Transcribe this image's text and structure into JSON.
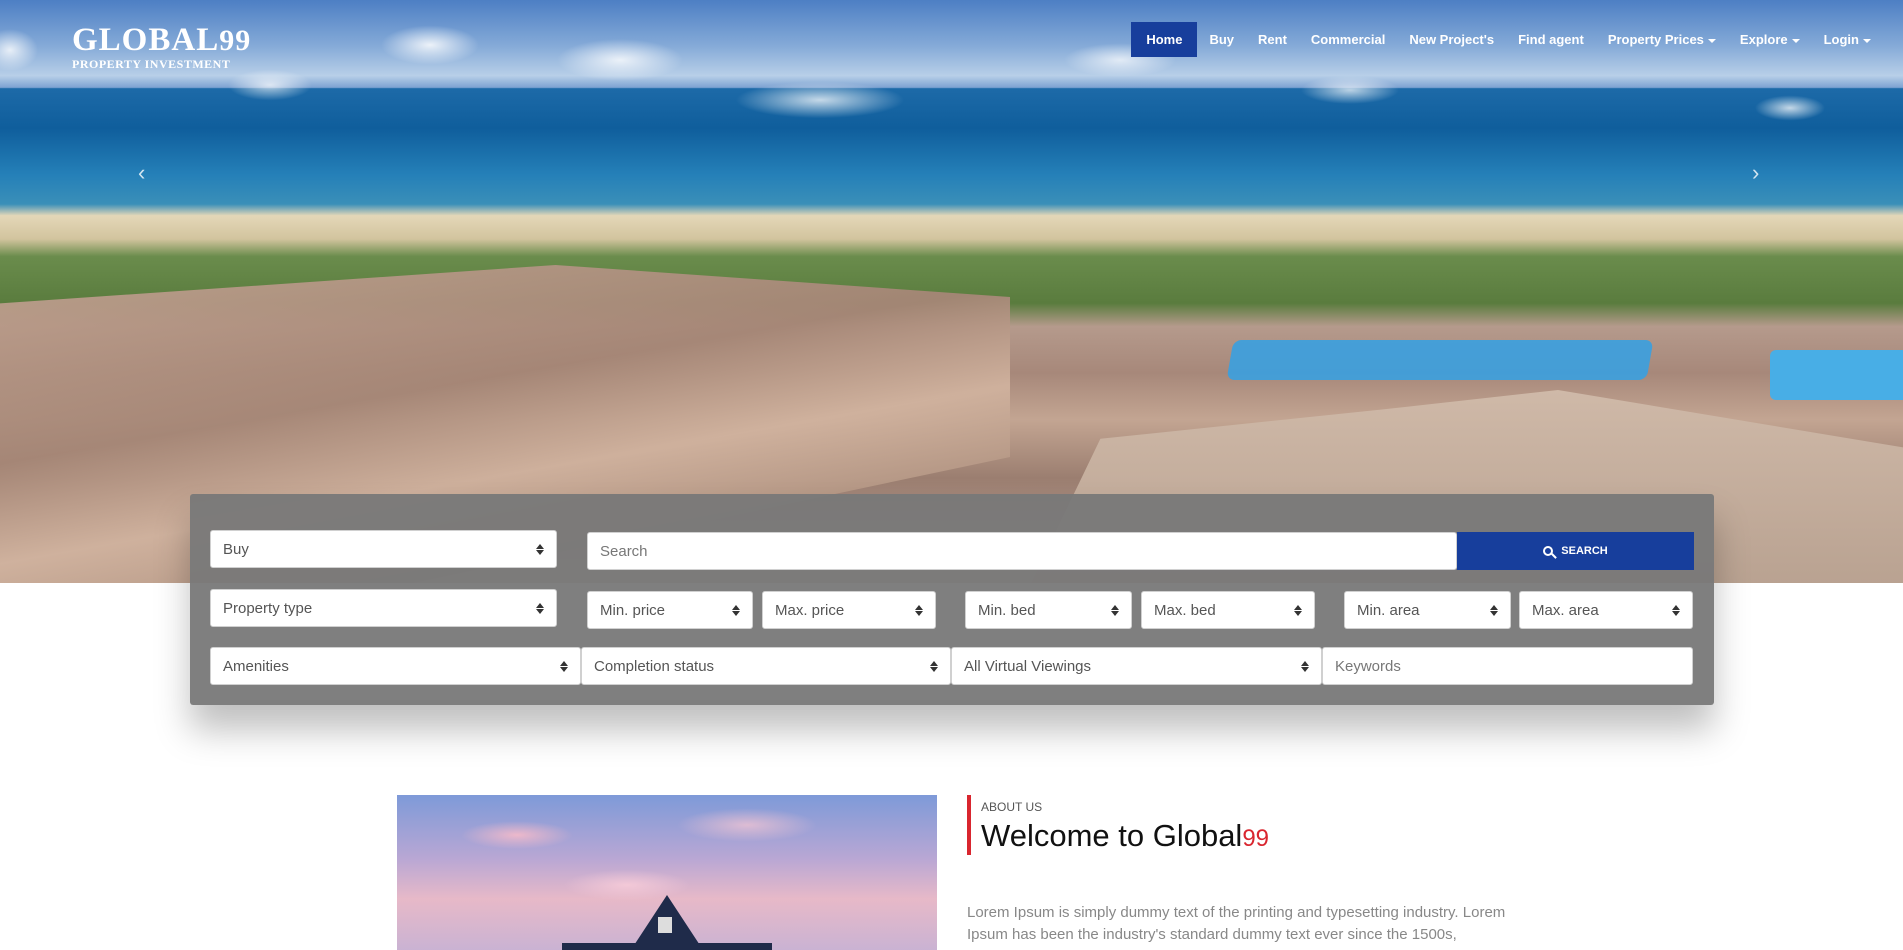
{
  "brand": {
    "name": "GLOBAL",
    "number": "99",
    "tagline": "PROPERTY INVESTMENT"
  },
  "nav": {
    "items": [
      {
        "label": "Home",
        "active": true
      },
      {
        "label": "Buy"
      },
      {
        "label": "Rent"
      },
      {
        "label": "Commercial"
      },
      {
        "label": "New Project's"
      },
      {
        "label": "Find agent"
      },
      {
        "label": "Property Prices",
        "dropdown": true
      },
      {
        "label": "Explore",
        "dropdown": true
      },
      {
        "label": "Login",
        "dropdown": true
      }
    ]
  },
  "carousel": {
    "prev_icon": "‹",
    "next_icon": "›"
  },
  "search": {
    "purpose": "Buy",
    "search_placeholder": "Search",
    "search_button": "SEARCH",
    "property_type": "Property type",
    "min_price": "Min. price",
    "max_price": "Max. price",
    "min_bed": "Min. bed",
    "max_bed": "Max. bed",
    "min_area": "Min. area",
    "max_area": "Max. area",
    "amenities": "Amenities",
    "completion_status": "Completion status",
    "virtual_viewings": "All Virtual Viewings",
    "keywords_placeholder": "Keywords"
  },
  "about": {
    "label": "ABOUT US",
    "title": "Welcome to Global",
    "title_number": "99",
    "text": "Lorem Ipsum is simply dummy text of the printing and typesetting industry. Lorem Ipsum has been the industry's standard dummy text ever since the 1500s,"
  },
  "colors": {
    "primary": "#173e9c",
    "accent": "#d9262f",
    "panel": "#787878"
  }
}
